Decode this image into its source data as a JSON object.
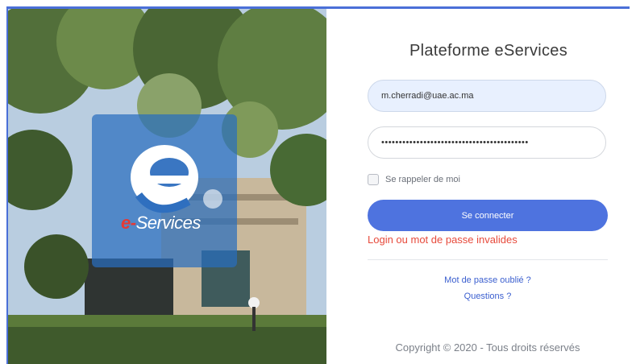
{
  "hero": {
    "logo_icon": "e-letter-logo",
    "logo_dash_text": "e-",
    "logo_text": "Services",
    "colors": {
      "logo_card": "#2f6fbf",
      "logo_red": "#e53935"
    }
  },
  "login": {
    "title": "Plateforme eServices",
    "email_value": "m.cherradi@uae.ac.ma",
    "password_value": "••••••••••••••••••••••••••••••••••••••••••",
    "remember_label": "Se rappeler de moi",
    "connect_label": "Se connecter",
    "error_message": "Login ou mot de passe invalides",
    "forgot_link": "Mot de passe oublié ?",
    "questions_link": "Questions ?",
    "copyright": "Copyright © 2020 - Tous droits réservés",
    "colors": {
      "accent": "#4e73df",
      "error": "#e74a3b"
    }
  }
}
